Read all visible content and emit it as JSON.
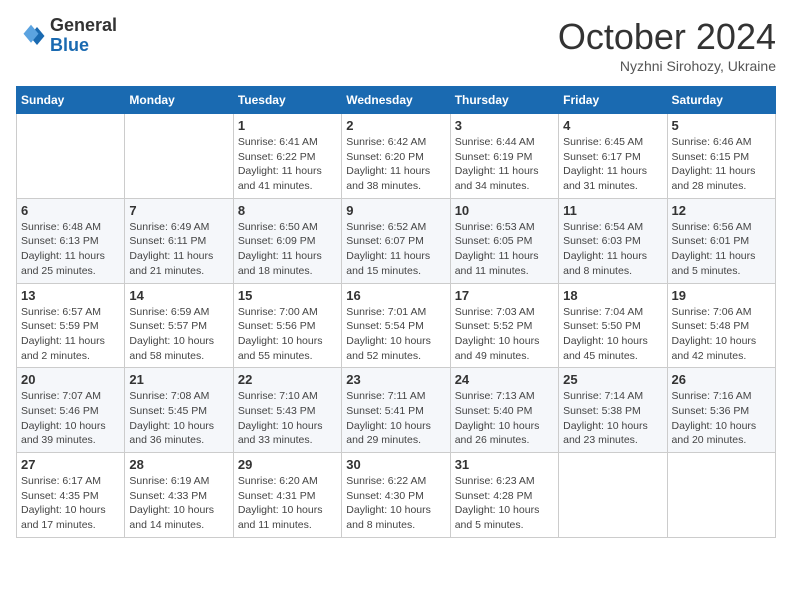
{
  "header": {
    "logo_general": "General",
    "logo_blue": "Blue",
    "month": "October 2024",
    "location": "Nyzhni Sirohozy, Ukraine"
  },
  "days_of_week": [
    "Sunday",
    "Monday",
    "Tuesday",
    "Wednesday",
    "Thursday",
    "Friday",
    "Saturday"
  ],
  "weeks": [
    [
      {
        "day": "",
        "info": ""
      },
      {
        "day": "",
        "info": ""
      },
      {
        "day": "1",
        "info": "Sunrise: 6:41 AM\nSunset: 6:22 PM\nDaylight: 11 hours and 41 minutes."
      },
      {
        "day": "2",
        "info": "Sunrise: 6:42 AM\nSunset: 6:20 PM\nDaylight: 11 hours and 38 minutes."
      },
      {
        "day": "3",
        "info": "Sunrise: 6:44 AM\nSunset: 6:19 PM\nDaylight: 11 hours and 34 minutes."
      },
      {
        "day": "4",
        "info": "Sunrise: 6:45 AM\nSunset: 6:17 PM\nDaylight: 11 hours and 31 minutes."
      },
      {
        "day": "5",
        "info": "Sunrise: 6:46 AM\nSunset: 6:15 PM\nDaylight: 11 hours and 28 minutes."
      }
    ],
    [
      {
        "day": "6",
        "info": "Sunrise: 6:48 AM\nSunset: 6:13 PM\nDaylight: 11 hours and 25 minutes."
      },
      {
        "day": "7",
        "info": "Sunrise: 6:49 AM\nSunset: 6:11 PM\nDaylight: 11 hours and 21 minutes."
      },
      {
        "day": "8",
        "info": "Sunrise: 6:50 AM\nSunset: 6:09 PM\nDaylight: 11 hours and 18 minutes."
      },
      {
        "day": "9",
        "info": "Sunrise: 6:52 AM\nSunset: 6:07 PM\nDaylight: 11 hours and 15 minutes."
      },
      {
        "day": "10",
        "info": "Sunrise: 6:53 AM\nSunset: 6:05 PM\nDaylight: 11 hours and 11 minutes."
      },
      {
        "day": "11",
        "info": "Sunrise: 6:54 AM\nSunset: 6:03 PM\nDaylight: 11 hours and 8 minutes."
      },
      {
        "day": "12",
        "info": "Sunrise: 6:56 AM\nSunset: 6:01 PM\nDaylight: 11 hours and 5 minutes."
      }
    ],
    [
      {
        "day": "13",
        "info": "Sunrise: 6:57 AM\nSunset: 5:59 PM\nDaylight: 11 hours and 2 minutes."
      },
      {
        "day": "14",
        "info": "Sunrise: 6:59 AM\nSunset: 5:57 PM\nDaylight: 10 hours and 58 minutes."
      },
      {
        "day": "15",
        "info": "Sunrise: 7:00 AM\nSunset: 5:56 PM\nDaylight: 10 hours and 55 minutes."
      },
      {
        "day": "16",
        "info": "Sunrise: 7:01 AM\nSunset: 5:54 PM\nDaylight: 10 hours and 52 minutes."
      },
      {
        "day": "17",
        "info": "Sunrise: 7:03 AM\nSunset: 5:52 PM\nDaylight: 10 hours and 49 minutes."
      },
      {
        "day": "18",
        "info": "Sunrise: 7:04 AM\nSunset: 5:50 PM\nDaylight: 10 hours and 45 minutes."
      },
      {
        "day": "19",
        "info": "Sunrise: 7:06 AM\nSunset: 5:48 PM\nDaylight: 10 hours and 42 minutes."
      }
    ],
    [
      {
        "day": "20",
        "info": "Sunrise: 7:07 AM\nSunset: 5:46 PM\nDaylight: 10 hours and 39 minutes."
      },
      {
        "day": "21",
        "info": "Sunrise: 7:08 AM\nSunset: 5:45 PM\nDaylight: 10 hours and 36 minutes."
      },
      {
        "day": "22",
        "info": "Sunrise: 7:10 AM\nSunset: 5:43 PM\nDaylight: 10 hours and 33 minutes."
      },
      {
        "day": "23",
        "info": "Sunrise: 7:11 AM\nSunset: 5:41 PM\nDaylight: 10 hours and 29 minutes."
      },
      {
        "day": "24",
        "info": "Sunrise: 7:13 AM\nSunset: 5:40 PM\nDaylight: 10 hours and 26 minutes."
      },
      {
        "day": "25",
        "info": "Sunrise: 7:14 AM\nSunset: 5:38 PM\nDaylight: 10 hours and 23 minutes."
      },
      {
        "day": "26",
        "info": "Sunrise: 7:16 AM\nSunset: 5:36 PM\nDaylight: 10 hours and 20 minutes."
      }
    ],
    [
      {
        "day": "27",
        "info": "Sunrise: 6:17 AM\nSunset: 4:35 PM\nDaylight: 10 hours and 17 minutes."
      },
      {
        "day": "28",
        "info": "Sunrise: 6:19 AM\nSunset: 4:33 PM\nDaylight: 10 hours and 14 minutes."
      },
      {
        "day": "29",
        "info": "Sunrise: 6:20 AM\nSunset: 4:31 PM\nDaylight: 10 hours and 11 minutes."
      },
      {
        "day": "30",
        "info": "Sunrise: 6:22 AM\nSunset: 4:30 PM\nDaylight: 10 hours and 8 minutes."
      },
      {
        "day": "31",
        "info": "Sunrise: 6:23 AM\nSunset: 4:28 PM\nDaylight: 10 hours and 5 minutes."
      },
      {
        "day": "",
        "info": ""
      },
      {
        "day": "",
        "info": ""
      }
    ]
  ]
}
